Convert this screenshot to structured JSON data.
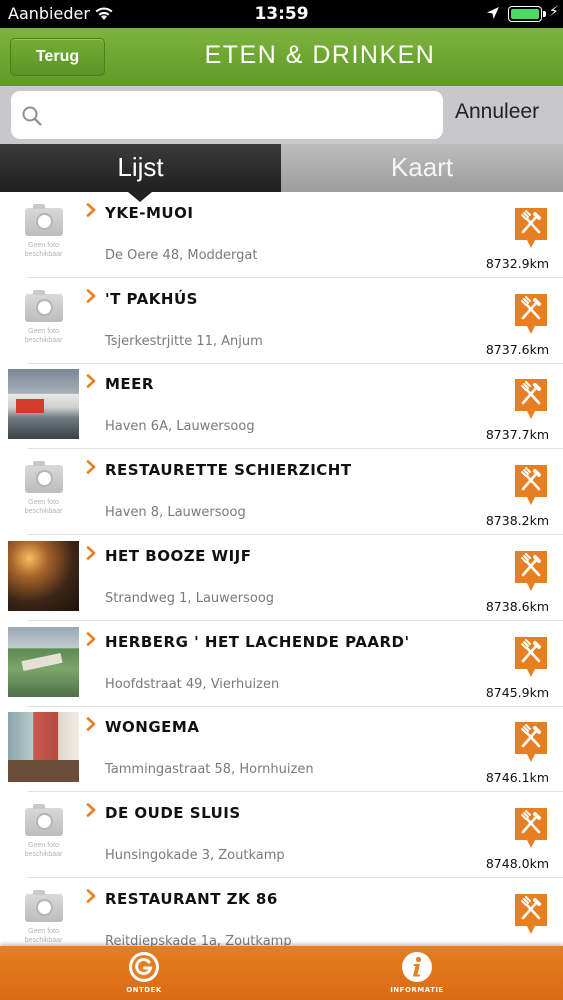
{
  "status_bar": {
    "carrier": "Aanbieder",
    "time": "13:59",
    "icons": [
      "wifi-icon",
      "location-arrow-icon",
      "battery-icon",
      "charging-bolt-icon"
    ]
  },
  "nav": {
    "back_label": "Terug",
    "title": "ETEN & DRINKEN"
  },
  "search": {
    "placeholder": "",
    "value": "",
    "cancel_label": "Annuleer"
  },
  "tabs": {
    "list_label": "Lijst",
    "map_label": "Kaart",
    "active": "Lijst"
  },
  "list": {
    "no_photo_line1": "Geen foto",
    "no_photo_line2": "beschikbaar",
    "items": [
      {
        "name": "YKE-MUOI",
        "address": "De Oere 48, Moddergat",
        "distance": "8732.9km",
        "photo": "none",
        "category_icon": "fork-knife-icon"
      },
      {
        "name": "'T PAKHÚS",
        "address": "Tsjerkestrjitte 11, Anjum",
        "distance": "8737.6km",
        "photo": "none",
        "category_icon": "fork-knife-icon"
      },
      {
        "name": "MEER",
        "address": "Haven 6A, Lauwersoog",
        "distance": "8737.7km",
        "photo": "meer",
        "category_icon": "fork-knife-icon"
      },
      {
        "name": "RESTAURETTE SCHIERZICHT",
        "address": "Haven 8, Lauwersoog",
        "distance": "8738.2km",
        "photo": "none",
        "category_icon": "fork-knife-icon"
      },
      {
        "name": "HET BOOZE WIJF",
        "address": "Strandweg 1, Lauwersoog",
        "distance": "8738.6km",
        "photo": "booze",
        "category_icon": "fork-knife-icon"
      },
      {
        "name": "HERBERG ' HET LACHENDE PAARD'",
        "address": "Hoofdstraat 49, Vierhuizen",
        "distance": "8745.9km",
        "photo": "herberg",
        "category_icon": "fork-knife-icon"
      },
      {
        "name": "WONGEMA",
        "address": "Tammingastraat 58, Hornhuizen",
        "distance": "8746.1km",
        "photo": "wongema",
        "category_icon": "fork-knife-icon"
      },
      {
        "name": "DE OUDE SLUIS",
        "address": "Hunsingokade 3, Zoutkamp",
        "distance": "8748.0km",
        "photo": "none",
        "category_icon": "fork-knife-icon"
      },
      {
        "name": "RESTAURANT ZK 86",
        "address": "Reitdiepskade 1a, Zoutkamp",
        "distance": "",
        "photo": "none",
        "category_icon": "fork-knife-icon"
      }
    ]
  },
  "tabbar": {
    "ontdek_label": "ONTDEK",
    "ontdek_icon": "g-logo-icon",
    "info_label": "INFORMATIE",
    "info_icon": "info-icon"
  },
  "colors": {
    "nav_green": "#6aa330",
    "accent_orange": "#e67e22",
    "tab_active": "#2a2a2a",
    "tab_inactive": "#a9a9a9"
  }
}
